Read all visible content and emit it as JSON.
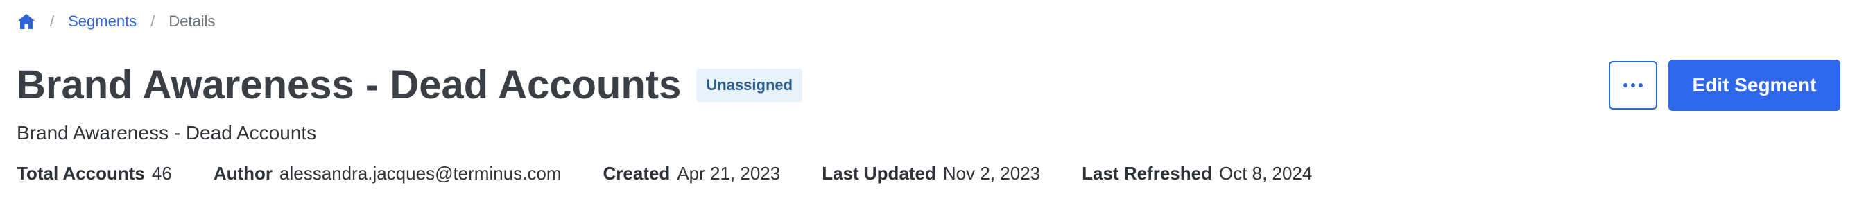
{
  "breadcrumb": {
    "home_icon": "home-icon",
    "separator": "/",
    "segments_label": "Segments",
    "current_label": "Details"
  },
  "header": {
    "title": "Brand Awareness - Dead Accounts",
    "status_badge": "Unassigned",
    "more_icon": "more-horizontal-icon",
    "edit_label": "Edit Segment"
  },
  "description": "Brand Awareness - Dead Accounts",
  "meta": {
    "items": [
      {
        "label": "Total Accounts",
        "value": "46"
      },
      {
        "label": "Author",
        "value": "alessandra.jacques@terminus.com"
      },
      {
        "label": "Created",
        "value": "Apr 21, 2023"
      },
      {
        "label": "Last Updated",
        "value": "Nov 2, 2023"
      },
      {
        "label": "Last Refreshed",
        "value": "Oct 8, 2024"
      }
    ]
  },
  "colors": {
    "link": "#2f63d8",
    "primary_button": "#2f67ea",
    "badge_bg": "#e7f2fb",
    "badge_text": "#2b5e8c"
  }
}
